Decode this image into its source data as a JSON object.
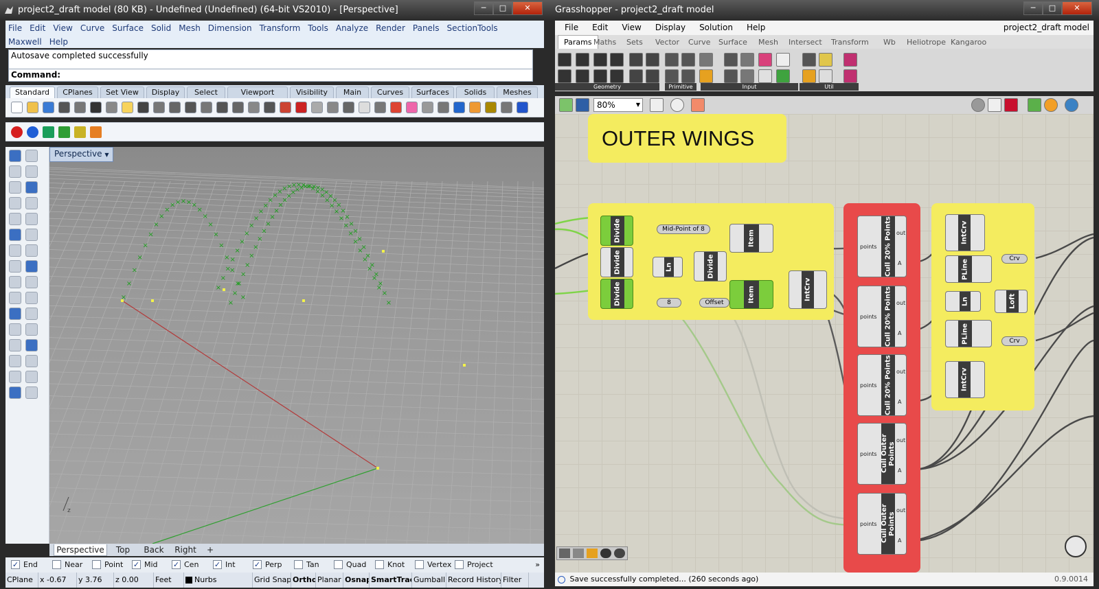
{
  "rhino": {
    "title": "project2_draft model (80 KB) - Undefined (Undefined) (64-bit VS2010) - [Perspective]",
    "menu": [
      "File",
      "Edit",
      "View",
      "Curve",
      "Surface",
      "Solid",
      "Mesh",
      "Dimension",
      "Transform",
      "Tools",
      "Analyze",
      "Render",
      "Panels",
      "SectionTools",
      "Maxwell",
      "Help"
    ],
    "history": "Autosave completed successfully",
    "command_label": "Command:",
    "tabs": [
      "Standard",
      "CPlanes",
      "Set View",
      "Display",
      "Select",
      "Viewport Layout",
      "Visibility",
      "Main",
      "Curves",
      "Surfaces",
      "Solids",
      "Meshes"
    ],
    "viewport_label": "Perspective",
    "view_tabs": [
      "Perspective",
      "Top",
      "Back",
      "Right"
    ],
    "osnaps": [
      {
        "label": "End",
        "checked": true
      },
      {
        "label": "Near",
        "checked": false
      },
      {
        "label": "Point",
        "checked": false
      },
      {
        "label": "Mid",
        "checked": true
      },
      {
        "label": "Cen",
        "checked": true
      },
      {
        "label": "Int",
        "checked": true
      },
      {
        "label": "Perp",
        "checked": true
      },
      {
        "label": "Tan",
        "checked": false
      },
      {
        "label": "Quad",
        "checked": false
      },
      {
        "label": "Knot",
        "checked": false
      },
      {
        "label": "Vertex",
        "checked": false
      },
      {
        "label": "Project",
        "checked": false
      }
    ],
    "status": {
      "cplane": "CPlane",
      "x": "x -0.67",
      "y": "y 3.76",
      "z": "z 0.00",
      "units": "Feet",
      "layer": "Nurbs",
      "grid": "Grid Snap",
      "ortho": "Ortho",
      "planar": "Planar",
      "osnap": "Osnap",
      "smarttrack": "SmartTrack",
      "gumball": "Gumball",
      "record": "Record History",
      "filter": "Filter"
    }
  },
  "gh": {
    "title": "Grasshopper - project2_draft model",
    "menu": [
      "File",
      "Edit",
      "View",
      "Display",
      "Solution",
      "Help"
    ],
    "doc_name": "project2_draft model",
    "tabs": [
      "Params",
      "Maths",
      "Sets",
      "Vector",
      "Curve",
      "Surface",
      "Mesh",
      "Intersect",
      "Transform",
      "Wb",
      "Heliotrope",
      "Kangaroo"
    ],
    "ribbon_groups": [
      "Geometry",
      "Primitive",
      "Input",
      "Util"
    ],
    "zoom": "80%",
    "group_title": "OUTER WINGS",
    "components": {
      "divide": "Divide",
      "mid": "Mid-Point of 8",
      "item": "Item",
      "ln": "Ln",
      "eight": "8",
      "offset": "Offset",
      "intcrv": "IntCrv",
      "pline": "PLine",
      "loft": "Loft",
      "crv": "Crv",
      "cull20": "Cull 20% Points",
      "cullouter": "Cull Outer Points",
      "points": "points",
      "out": "out",
      "a": "A"
    },
    "status": "Save successfully completed... (260 seconds ago)",
    "version": "0.9.0014"
  },
  "colors": {
    "accent": "#1e3a78",
    "gh_group": "#f4ec5f",
    "gh_red": "#e84a4a",
    "gh_green": "#7ccd3c",
    "point": "#1d9e1d"
  }
}
